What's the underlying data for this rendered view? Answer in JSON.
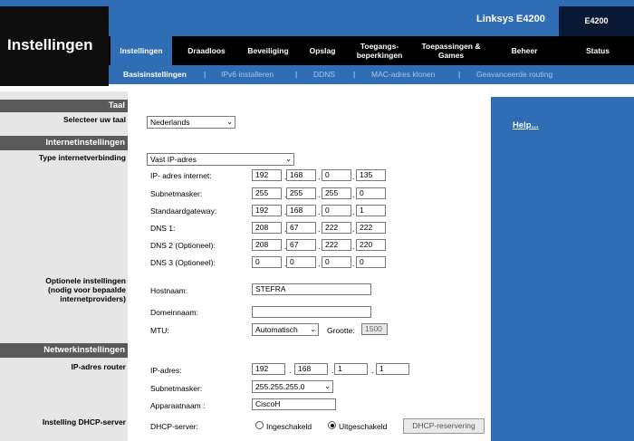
{
  "header": {
    "page_title": "Instellingen",
    "product_name": "Linksys E4200",
    "model": "E4200"
  },
  "nav": {
    "tabs": [
      {
        "label": "Instellingen",
        "active": true
      },
      {
        "label": "Draadloos"
      },
      {
        "label": "Beveiliging"
      },
      {
        "label": "Opslag"
      },
      {
        "label": "Toegangs-\nbeperkingen"
      },
      {
        "label": "Toepassingen &\nGames"
      },
      {
        "label": "Beheer"
      },
      {
        "label": "Status"
      }
    ],
    "subtabs": [
      {
        "label": "Basisinstellingen",
        "active": true
      },
      {
        "label": "IPv6 installeren"
      },
      {
        "label": "DDNS"
      },
      {
        "label": "MAC-adres klonen"
      },
      {
        "label": "Geavanceerde routing"
      }
    ],
    "separator": "|"
  },
  "help": {
    "label": "Help..."
  },
  "sections": {
    "taal": "Taal",
    "internet": "Internetinstellingen",
    "netwerk": "Netwerkinstellingen"
  },
  "labels": {
    "selecteer_taal": "Selecteer uw taal",
    "type_verbinding": "Type internetverbinding",
    "optionele": "Optionele instellingen\n(nodig voor bepaalde\ninternetproviders)",
    "ip_router": "IP-adres router",
    "dhcp_instelling": "Instelling DHCP-server"
  },
  "language": {
    "selected": "Nederlands"
  },
  "connection": {
    "selected": "Vast IP-adres"
  },
  "static_ip": {
    "fields": [
      {
        "label": "IP- adres internet:",
        "octets": [
          "192",
          "168",
          "0",
          "135"
        ]
      },
      {
        "label": "Subnetmasker:",
        "octets": [
          "255",
          "255",
          "255",
          "0"
        ]
      },
      {
        "label": "Standaardgateway:",
        "octets": [
          "192",
          "168",
          "0",
          "1"
        ]
      },
      {
        "label": "DNS 1:",
        "octets": [
          "208",
          "67",
          "222",
          "222"
        ]
      },
      {
        "label": "DNS 2 (Optioneel):",
        "octets": [
          "208",
          "67",
          "222",
          "220"
        ]
      },
      {
        "label": "DNS 3 (Optioneel):",
        "octets": [
          "0",
          "0",
          "0",
          "0"
        ]
      }
    ],
    "dot": "."
  },
  "optional": {
    "hostname_label": "Hostnaam:",
    "hostname_value": "STEFRA",
    "domain_label": "Domeinnaam:",
    "domain_value": "",
    "mtu_label": "MTU:",
    "mtu_selected": "Automatisch",
    "size_label": "Grootte:",
    "size_value": "1500"
  },
  "router": {
    "ip_label": "IP-adres:",
    "ip_octets": [
      "192",
      "168",
      "1",
      "1"
    ],
    "subnet_label": "Subnetmasker:",
    "subnet_selected": "255.255.255.0",
    "device_label": "Apparaatnaam :",
    "device_value": "CiscoH"
  },
  "dhcp": {
    "label": "DHCP-server:",
    "option_on": "Ingeschakeld",
    "option_off": "Uitgeschakeld",
    "selected": "off",
    "reservation_button": "DHCP-reservering"
  },
  "colors": {
    "brand_blue": "#2f6db5",
    "nav_black": "#000000",
    "section_gray": "#5a5a5a",
    "left_panel": "#e6e6e6"
  }
}
